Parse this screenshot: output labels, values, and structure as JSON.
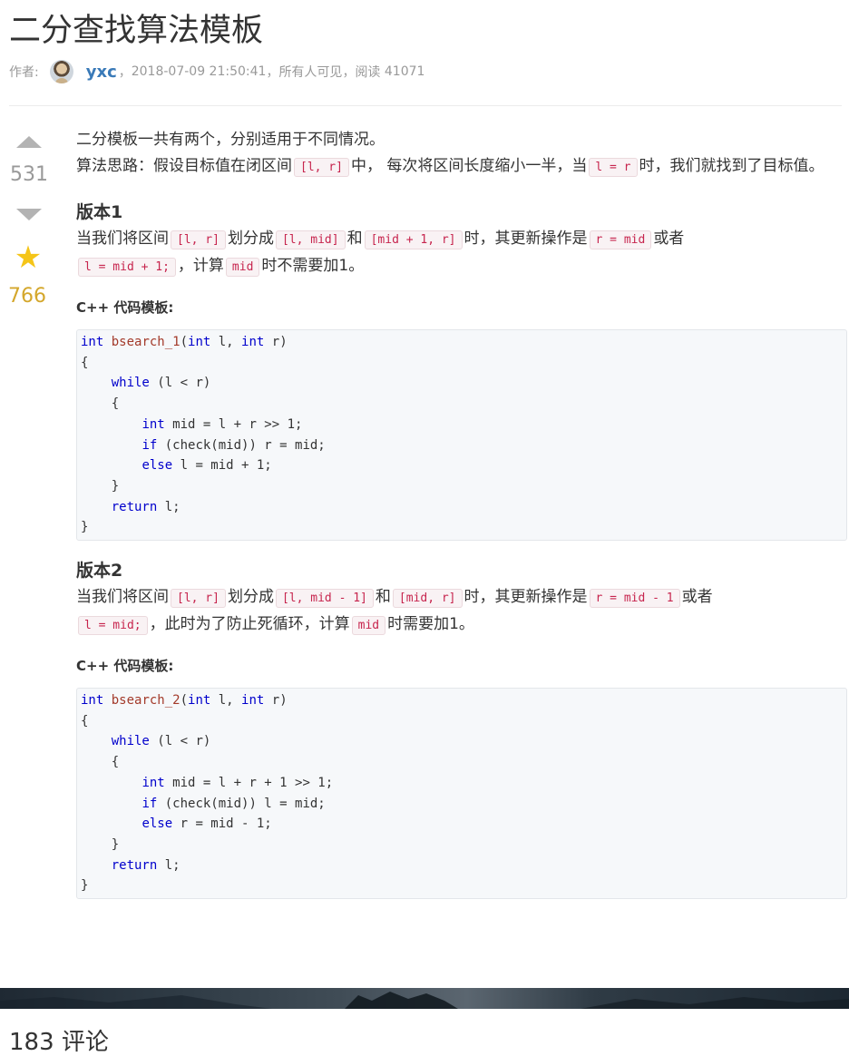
{
  "article": {
    "title": "二分查找算法模板",
    "meta": {
      "author_label": "作者:",
      "author": "yxc",
      "timestamp": "2018-07-09 21:50:41",
      "visibility": "所有人可见",
      "reads_label": "阅读",
      "reads": "41071"
    }
  },
  "votes": {
    "up_count": "531",
    "fav_count": "766"
  },
  "content": {
    "intro1": "二分模板一共有两个，分别适用于不同情况。",
    "intro2_a": "算法思路：假设目标值在闭区间",
    "intro2_code1": "[l, r]",
    "intro2_b": "中， 每次将区间长度缩小一半，当",
    "intro2_code2": "l = r",
    "intro2_c": "时，我们就找到了目标值。",
    "v1": {
      "heading": "版本1",
      "t1": "当我们将区间",
      "c1": "[l, r]",
      "t2": "划分成",
      "c2": "[l, mid]",
      "t3": "和",
      "c3": "[mid + 1, r]",
      "t4": "时，其更新操作是",
      "c4": "r = mid",
      "t5": "或者",
      "c5": "l = mid + 1;",
      "t6": "，计算",
      "c6": "mid",
      "t7": "时不需要加1。",
      "lang_label": "C++ 代码模板:",
      "code": {
        "l1_kw": "int",
        "l1_fn": "bsearch_1",
        "l1_p1": "(",
        "l1_kw2": "int",
        "l1_p2": " l, ",
        "l1_kw3": "int",
        "l1_p3": " r)",
        "l2": "{",
        "l3_kw": "while",
        "l3_rest": " (l < r)",
        "l4": "{",
        "l5_kw": "int",
        "l5_rest": " mid = l + r >> 1;",
        "l6_kw": "if",
        "l6_rest": " (check(mid)) r = mid;",
        "l7_kw": "else",
        "l7_rest": " l = mid + 1;",
        "l8": "}",
        "l9_kw": "return",
        "l9_rest": " l;",
        "l10": "}"
      }
    },
    "v2": {
      "heading": "版本2",
      "t1": "当我们将区间",
      "c1": "[l, r]",
      "t2": "划分成",
      "c2": "[l, mid - 1]",
      "t3": "和",
      "c3": "[mid, r]",
      "t4": "时，其更新操作是",
      "c4": "r = mid - 1",
      "t5": "或者",
      "c5": "l = mid;",
      "t6": "，此时为了防止死循环，计算",
      "c6": "mid",
      "t7": "时需要加1。",
      "lang_label": "C++ 代码模板:",
      "code": {
        "l1_kw": "int",
        "l1_fn": "bsearch_2",
        "l1_p1": "(",
        "l1_kw2": "int",
        "l1_p2": " l, ",
        "l1_kw3": "int",
        "l1_p3": " r)",
        "l2": "{",
        "l3_kw": "while",
        "l3_rest": " (l < r)",
        "l4": "{",
        "l5_kw": "int",
        "l5_rest": " mid = l + r + 1 >> 1;",
        "l6_kw": "if",
        "l6_rest": " (check(mid)) l = mid;",
        "l7_kw": "else",
        "l7_rest": " r = mid - 1;",
        "l8": "}",
        "l9_kw": "return",
        "l9_rest": " l;",
        "l10": "}"
      }
    }
  },
  "comments": {
    "heading": "183 评论"
  }
}
